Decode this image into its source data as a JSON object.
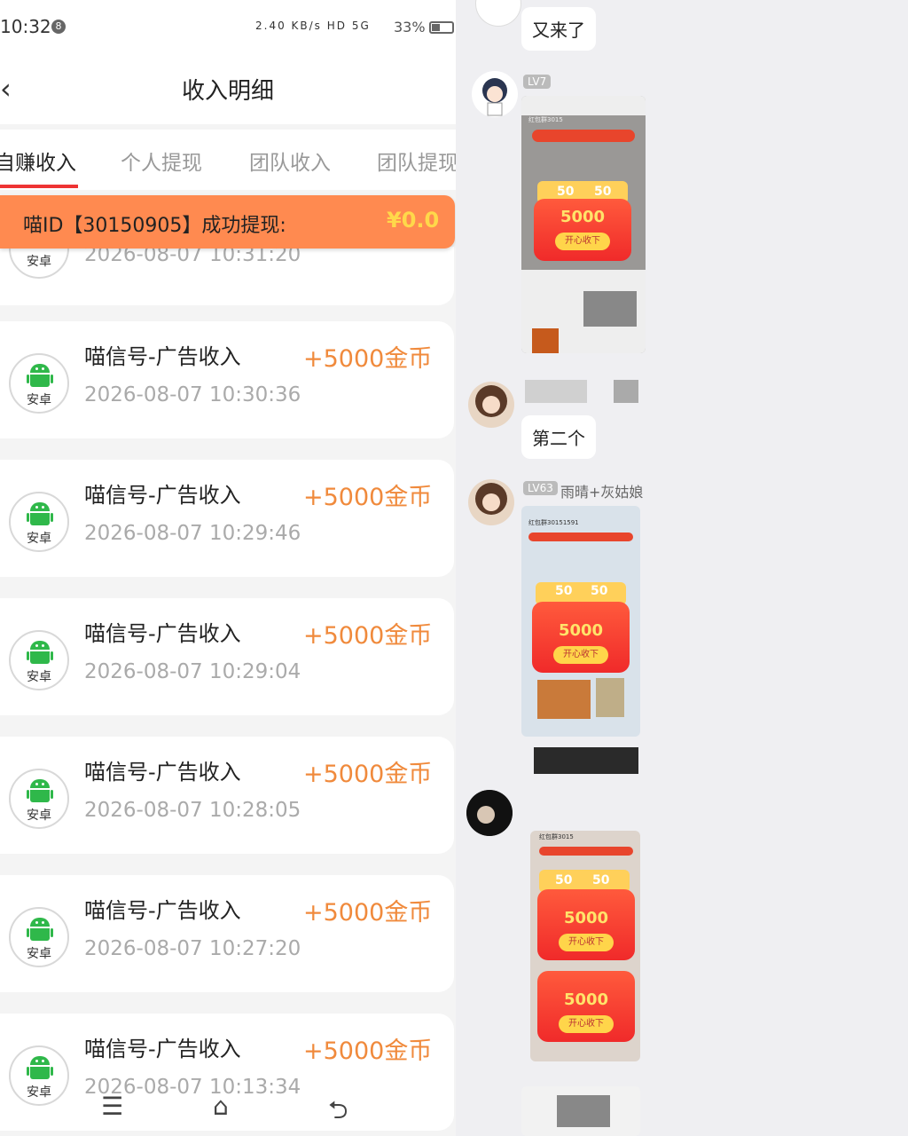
{
  "status_bar": {
    "time": "10:32",
    "badge": "8",
    "icons": "2.40 KB/s HD 5G",
    "battery": "33%"
  },
  "header": {
    "title": "收入明细"
  },
  "tabs": [
    {
      "label": "自赚收入"
    },
    {
      "label": "个人提现"
    },
    {
      "label": "团队收入"
    },
    {
      "label": "团队提现"
    }
  ],
  "banner": {
    "text": "喵ID【30150905】成功提现:",
    "amount": "¥0.0"
  },
  "partial_row": {
    "date": "2026-08-07 10:31:20",
    "platform": "安卓"
  },
  "records": [
    {
      "title": "喵信号-广告收入",
      "amount": "+5000金币",
      "date": "2026-08-07 10:30:36",
      "platform": "安卓"
    },
    {
      "title": "喵信号-广告收入",
      "amount": "+5000金币",
      "date": "2026-08-07 10:29:46",
      "platform": "安卓"
    },
    {
      "title": "喵信号-广告收入",
      "amount": "+5000金币",
      "date": "2026-08-07 10:29:04",
      "platform": "安卓"
    },
    {
      "title": "喵信号-广告收入",
      "amount": "+5000金币",
      "date": "2026-08-07 10:28:05",
      "platform": "安卓"
    },
    {
      "title": "喵信号-广告收入",
      "amount": "+5000金币",
      "date": "2026-08-07 10:27:20",
      "platform": "安卓"
    },
    {
      "title": "喵信号-广告收入",
      "amount": "+5000金币",
      "date": "2026-08-07 10:13:34",
      "platform": "安卓"
    }
  ],
  "bottom_nav": {
    "menu": "☰",
    "home": "⌂",
    "back": "⮌"
  },
  "chat": {
    "messages": [
      {
        "text": "又来了"
      },
      {
        "level": "LV7"
      },
      {
        "text": "第二个"
      },
      {
        "level": "LV63",
        "name": "雨晴+灰姑娘"
      }
    ],
    "screenshot_texts": {
      "coins": "5000",
      "button": "开心收下",
      "tile50": "50",
      "group_1": "红包群3015",
      "group_2": "红包群30151591",
      "group_3": "红包群3015"
    }
  },
  "colors": {
    "accent": "#e33",
    "banner": "#ff8a50",
    "amount": "#f08a3c",
    "android": "#2fb84a"
  }
}
